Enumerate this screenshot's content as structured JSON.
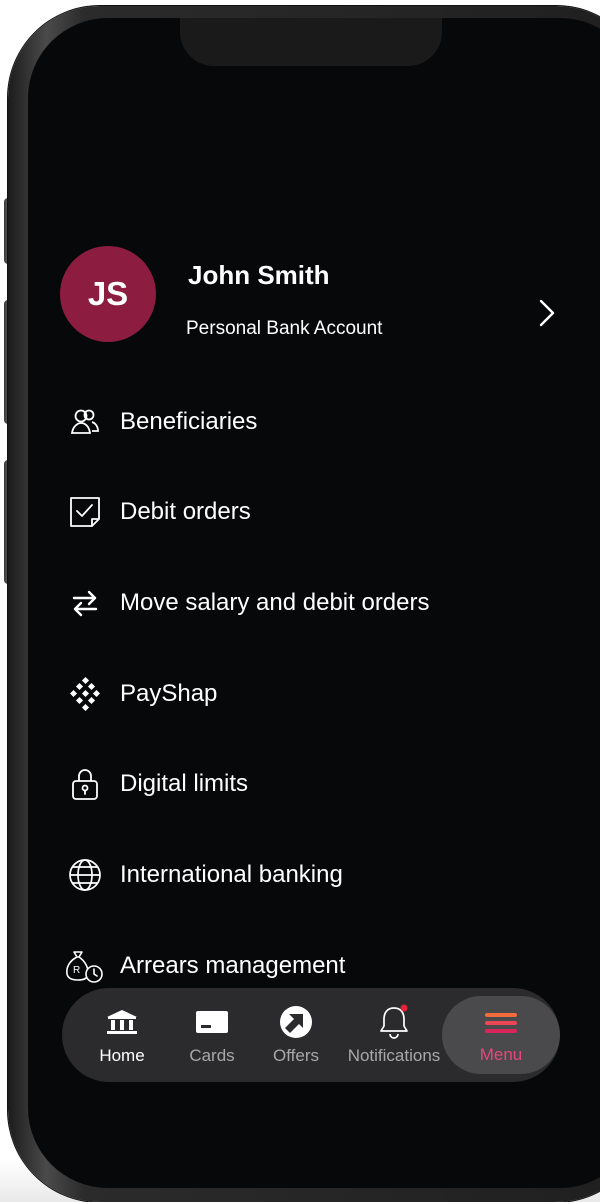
{
  "profile": {
    "initials": "JS",
    "name": "John Smith",
    "account_type": "Personal Bank Account"
  },
  "menu": {
    "items": [
      {
        "label": "Beneficiaries",
        "icon": "people-icon"
      },
      {
        "label": "Debit orders",
        "icon": "checkbox-icon"
      },
      {
        "label": "Move salary and debit orders",
        "icon": "swap-arrows-icon"
      },
      {
        "label": "PayShap",
        "icon": "payshap-diamond-icon"
      },
      {
        "label": "Digital limits",
        "icon": "lock-icon"
      },
      {
        "label": "International banking",
        "icon": "globe-icon"
      },
      {
        "label": "Arrears management",
        "icon": "money-bag-clock-icon"
      }
    ]
  },
  "nav": {
    "home": "Home",
    "cards": "Cards",
    "offers": "Offers",
    "notifications": "Notifications",
    "menu": "Menu"
  },
  "colors": {
    "avatar": "#8c1d40",
    "accent": "#e8457a",
    "notification_dot": "#e5243b",
    "background": "#07080a"
  }
}
